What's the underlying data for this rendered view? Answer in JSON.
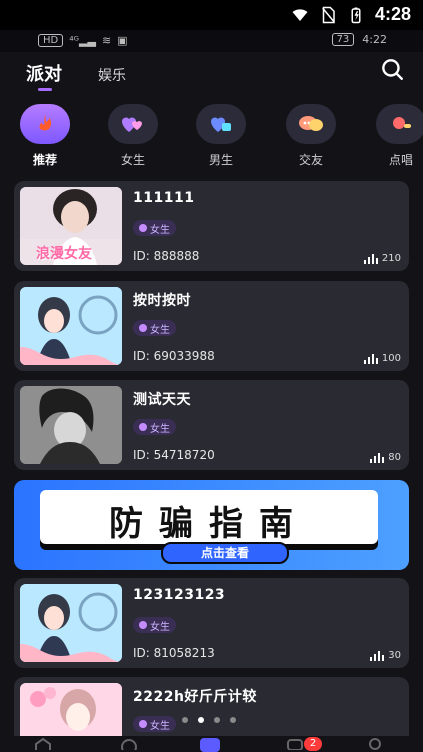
{
  "system": {
    "time": "4:28",
    "secondary_time": "4:22",
    "battery": "73"
  },
  "top_tabs": {
    "party": "派对",
    "entertainment": "娱乐"
  },
  "categories": [
    {
      "label": "推荐",
      "icon": "flame-icon",
      "active": true
    },
    {
      "label": "女生",
      "icon": "hearts-icon",
      "active": false
    },
    {
      "label": "男生",
      "icon": "heart-gift-icon",
      "active": false
    },
    {
      "label": "交友",
      "icon": "chat-bubbles-icon",
      "active": false
    },
    {
      "label": "点唱",
      "icon": "mic-icon",
      "active": false
    }
  ],
  "rooms": [
    {
      "title": "111111",
      "tag": "女生",
      "id_text": "ID: 888888",
      "heat": "210"
    },
    {
      "title": "按时按时",
      "tag": "女生",
      "id_text": "ID: 69033988",
      "heat": "100"
    },
    {
      "title": "测试天天",
      "tag": "女生",
      "id_text": "ID: 54718720",
      "heat": "80"
    },
    {
      "title": "123123123",
      "tag": "女生",
      "id_text": "ID: 81058213",
      "heat": "30"
    },
    {
      "title": "2222h好斤斤计较",
      "tag": "女生",
      "id_text": "",
      "heat": ""
    }
  ],
  "thumb_texts": {
    "first": "浪漫女友"
  },
  "banner": {
    "title": "防骗指南",
    "cta": "点击查看"
  },
  "carousel_dots": {
    "count": 4,
    "active_index": 1
  },
  "bottom_nav": {
    "notification_count": "2"
  },
  "colors": {
    "background": "#121217",
    "card": "#2a2a33",
    "accent_purple": "#a86bff",
    "banner_blue": "#2b74ff",
    "badge_red": "#ff3b3b"
  }
}
